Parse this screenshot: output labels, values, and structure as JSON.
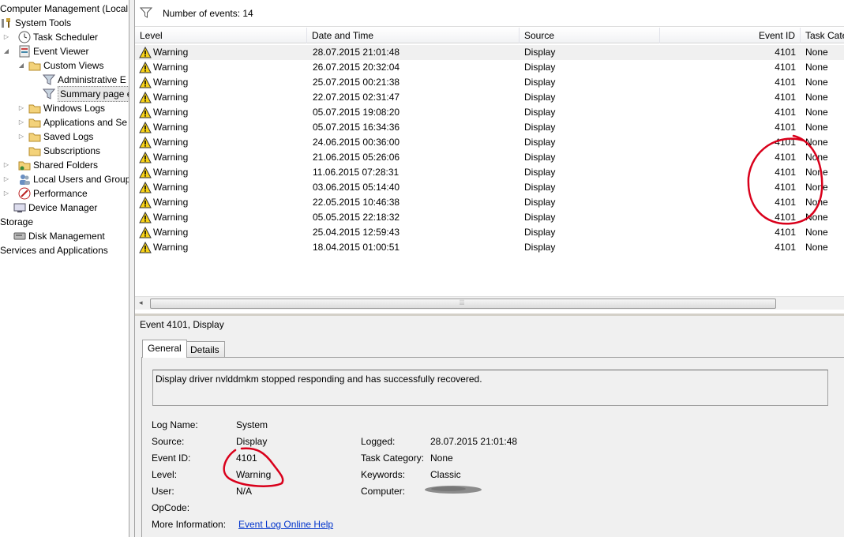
{
  "tree": {
    "root": "Computer Management (Local",
    "items": [
      {
        "label": "System Tools"
      },
      {
        "label": "Task Scheduler"
      },
      {
        "label": "Event Viewer"
      },
      {
        "label": "Custom Views"
      },
      {
        "label": "Administrative E"
      },
      {
        "label": "Summary page e"
      },
      {
        "label": "Windows Logs"
      },
      {
        "label": "Applications and Se"
      },
      {
        "label": "Saved Logs"
      },
      {
        "label": "Subscriptions"
      },
      {
        "label": "Shared Folders"
      },
      {
        "label": "Local Users and Groups"
      },
      {
        "label": "Performance"
      },
      {
        "label": "Device Manager"
      },
      {
        "label": "Storage"
      },
      {
        "label": "Disk Management"
      },
      {
        "label": "Services and Applications"
      }
    ]
  },
  "events": {
    "count_label": "Number of events: 14",
    "columns": [
      "Level",
      "Date and Time",
      "Source",
      "Event ID",
      "Task Cate"
    ],
    "rows": [
      {
        "level": "Warning",
        "datetime": "28.07.2015 21:01:48",
        "source": "Display",
        "event_id": "4101",
        "task": "None"
      },
      {
        "level": "Warning",
        "datetime": "26.07.2015 20:32:04",
        "source": "Display",
        "event_id": "4101",
        "task": "None"
      },
      {
        "level": "Warning",
        "datetime": "25.07.2015 00:21:38",
        "source": "Display",
        "event_id": "4101",
        "task": "None"
      },
      {
        "level": "Warning",
        "datetime": "22.07.2015 02:31:47",
        "source": "Display",
        "event_id": "4101",
        "task": "None"
      },
      {
        "level": "Warning",
        "datetime": "05.07.2015 19:08:20",
        "source": "Display",
        "event_id": "4101",
        "task": "None"
      },
      {
        "level": "Warning",
        "datetime": "05.07.2015 16:34:36",
        "source": "Display",
        "event_id": "4101",
        "task": "None"
      },
      {
        "level": "Warning",
        "datetime": "24.06.2015 00:36:00",
        "source": "Display",
        "event_id": "4101",
        "task": "None"
      },
      {
        "level": "Warning",
        "datetime": "21.06.2015 05:26:06",
        "source": "Display",
        "event_id": "4101",
        "task": "None"
      },
      {
        "level": "Warning",
        "datetime": "11.06.2015 07:28:31",
        "source": "Display",
        "event_id": "4101",
        "task": "None"
      },
      {
        "level": "Warning",
        "datetime": "03.06.2015 05:14:40",
        "source": "Display",
        "event_id": "4101",
        "task": "None"
      },
      {
        "level": "Warning",
        "datetime": "22.05.2015 10:46:38",
        "source": "Display",
        "event_id": "4101",
        "task": "None"
      },
      {
        "level": "Warning",
        "datetime": "05.05.2015 22:18:32",
        "source": "Display",
        "event_id": "4101",
        "task": "None"
      },
      {
        "level": "Warning",
        "datetime": "25.04.2015 12:59:43",
        "source": "Display",
        "event_id": "4101",
        "task": "None"
      },
      {
        "level": "Warning",
        "datetime": "18.04.2015 01:00:51",
        "source": "Display",
        "event_id": "4101",
        "task": "None"
      }
    ]
  },
  "details": {
    "title": "Event 4101, Display",
    "tabs": [
      "General",
      "Details"
    ],
    "description": "Display driver nvlddmkm stopped responding and has successfully recovered.",
    "log_name_label": "Log Name:",
    "log_name": "System",
    "source_label": "Source:",
    "source": "Display",
    "event_id_label": "Event ID:",
    "event_id": "4101",
    "level_label": "Level:",
    "level": "Warning",
    "user_label": "User:",
    "user": "N/A",
    "opcode_label": "OpCode:",
    "more_info_label": "More Information:",
    "more_info_link": "Event Log Online Help",
    "logged_label": "Logged:",
    "logged": "28.07.2015 21:01:48",
    "task_category_label": "Task Category:",
    "task_category": "None",
    "keywords_label": "Keywords:",
    "keywords": "Classic",
    "computer_label": "Computer:"
  },
  "icons": [
    "folder-icon",
    "clock-icon",
    "event-viewer-icon",
    "filter-icon",
    "warning-icon",
    "shared-folder-icon",
    "users-icon",
    "performance-icon",
    "device-manager-icon",
    "storage-icon",
    "disk-icon",
    "services-icon"
  ],
  "colors": {
    "annotation": "#d9001b",
    "warning": "#f7d117",
    "link": "#0033cc"
  }
}
